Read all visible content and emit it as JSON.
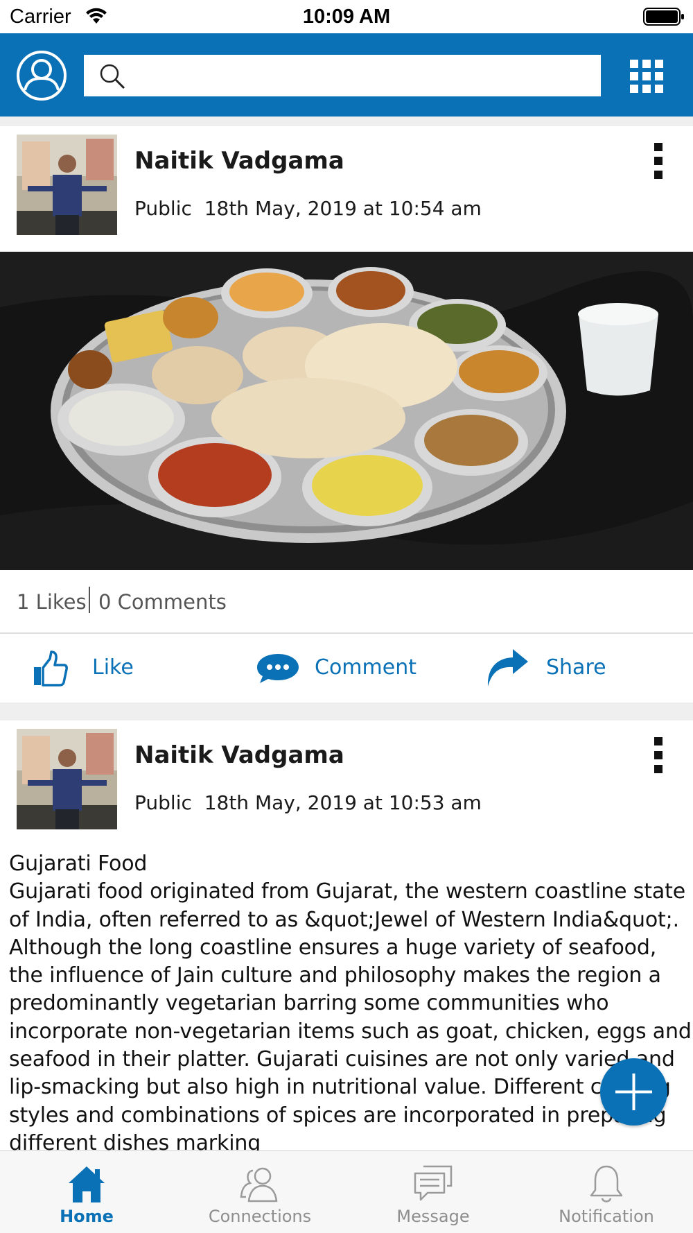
{
  "status_bar": {
    "carrier": "Carrier",
    "time": "10:09 AM"
  },
  "header": {
    "search_placeholder": "",
    "accent_color": "#0a71b6",
    "icons": [
      "profile-icon",
      "search-icon",
      "apps-grid-icon"
    ]
  },
  "posts": [
    {
      "author": "Naitik Vadgama",
      "visibility": "Public",
      "timestamp": "18th May, 2019 at 10:54 am",
      "image": "thali-photo",
      "likes": "1 Likes",
      "comments": "0 Comments",
      "actions": {
        "like": "Like",
        "comment": "Comment",
        "share": "Share"
      }
    },
    {
      "author": "Naitik Vadgama",
      "visibility": "Public",
      "timestamp": "18th May, 2019 at 10:53 am",
      "title": "Gujarati Food",
      "text": "Gujarati food originated from Gujarat, the western coastline state of India, often referred to as &quot;Jewel of Western India&quot;. Although the long coastline ensures a huge variety of seafood, the influence of Jain culture and philosophy makes the region a predominantly vegetarian barring some communities who incorporate non-vegetarian items such as goat, chicken, eggs and seafood in their platter. Gujarati cuisines are not only varied and lip-smacking but also high in nutritional value. Different cooking styles and combinations of spices are incorporated in preparing different dishes marking"
    }
  ],
  "tabs": [
    {
      "label": "Home",
      "icon": "home-icon",
      "active": true
    },
    {
      "label": "Connections",
      "icon": "connections-icon",
      "active": false
    },
    {
      "label": "Message",
      "icon": "message-icon",
      "active": false
    },
    {
      "label": "Notification",
      "icon": "notification-icon",
      "active": false
    }
  ]
}
